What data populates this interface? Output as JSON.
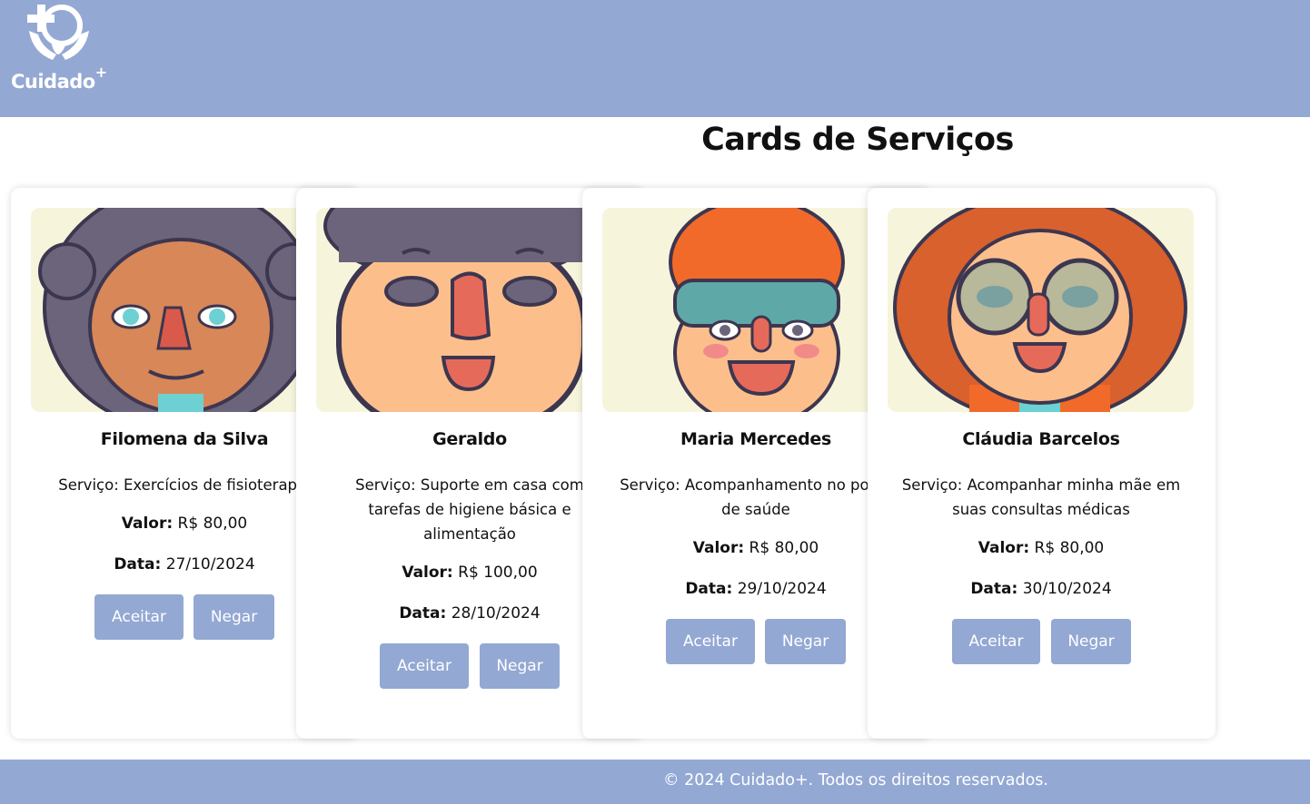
{
  "brand": {
    "name": "Cuidado",
    "plus": "+"
  },
  "page_title": "Cards de Serviços",
  "labels": {
    "service": "Serviço:",
    "value": "Valor:",
    "date": "Data:",
    "accept": "Aceitar",
    "deny": "Negar"
  },
  "cards": [
    {
      "name": "Filomena da Silva",
      "service_text": "Exercícios de fisioterapia",
      "value": "R$ 80,00",
      "date": "27/10/2024"
    },
    {
      "name": "Geraldo",
      "service_text": "Suporte em casa com tarefas de higiene básica e alimentação",
      "value": "R$ 100,00",
      "date": "28/10/2024"
    },
    {
      "name": "Maria Mercedes",
      "service_text": "Acompanhamento no posto de saúde",
      "value": "R$ 80,00",
      "date": "29/10/2024"
    },
    {
      "name": "Cláudia Barcelos",
      "service_text": "Acompanhar minha mãe em suas consultas médicas",
      "value": "R$ 80,00",
      "date": "30/10/2024"
    }
  ],
  "footer": {
    "text": "© 2024 Cuidado+. Todos os direitos reservados."
  },
  "colors": {
    "primary": "#93a8d3",
    "card_image_bg": "#f6f5dc"
  }
}
